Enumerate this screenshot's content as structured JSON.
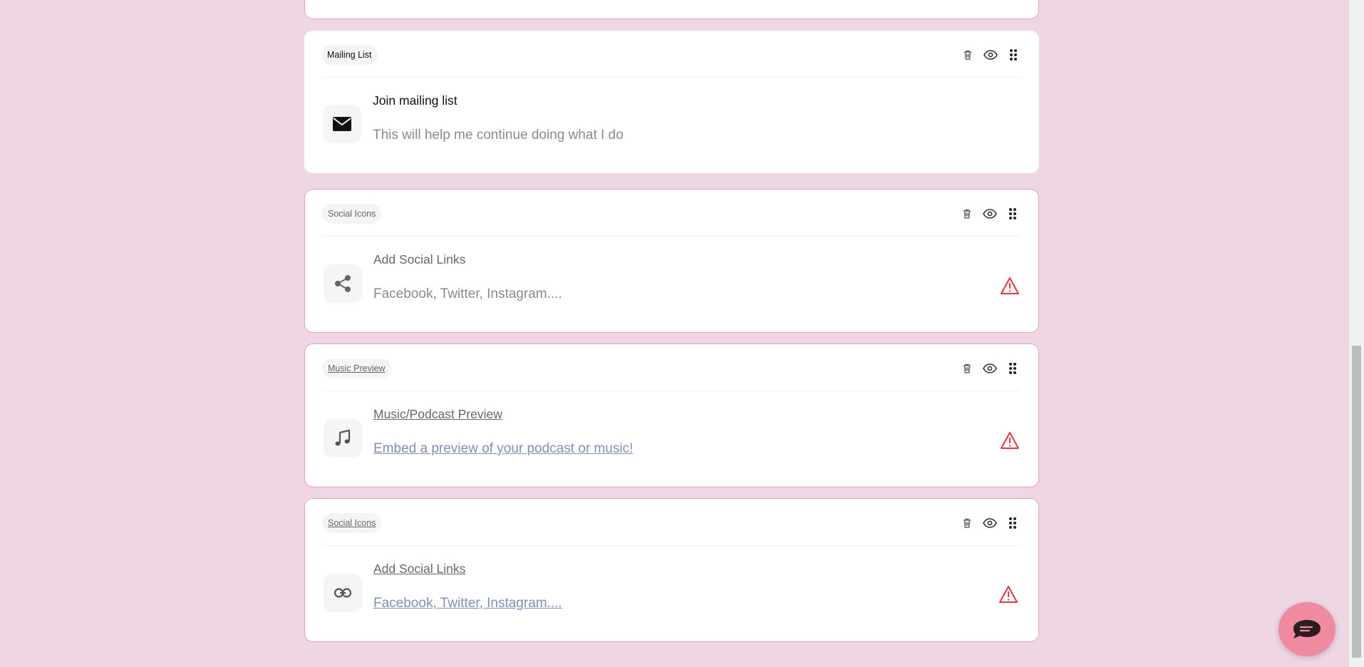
{
  "cards": [
    {
      "tag": "Mailing List",
      "title": "Join mailing list",
      "subtitle": "This will help me continue doing what I do",
      "icon": "mail-icon",
      "warning": false
    },
    {
      "tag": "Social Icons",
      "title": "Add Social Links",
      "subtitle": "Facebook, Twitter, Instagram....",
      "icon": "share-icon",
      "warning": true
    },
    {
      "tag": "Music Preview",
      "title": "Music/Podcast Preview",
      "subtitle": "Embed a preview of your podcast or music!",
      "icon": "music-note-icon",
      "warning": true
    },
    {
      "tag": "Social Icons",
      "title": "Add Social Links",
      "subtitle": "Facebook, Twitter, Instagram....",
      "icon": "link-icon",
      "warning": true
    }
  ],
  "actions": [
    "trash-icon",
    "eye-icon",
    "drag-handle-icon"
  ],
  "colors": {
    "background": "#eed6e4",
    "card_border_warning": "#e7a2b6",
    "warning_icon": "#e0393e",
    "chat_button": "#f08aa0"
  }
}
